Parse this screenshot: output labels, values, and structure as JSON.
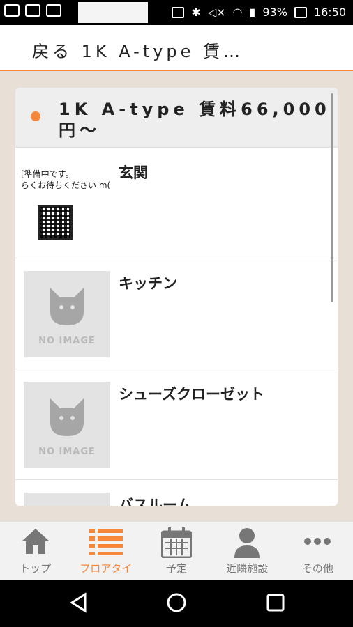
{
  "status_bar": {
    "battery": "93%",
    "time": "16:50"
  },
  "header": {
    "title": "戻る 1K A-type 賃…"
  },
  "card": {
    "title": "1K A-type 賃料66,000円～"
  },
  "rooms": [
    {
      "label": "玄関",
      "placeholder_lines": [
        "[準備中です。",
        "らくお待ちください m("
      ]
    },
    {
      "label": "キッチン",
      "no_image": "NO IMAGE"
    },
    {
      "label": "シューズクローゼット",
      "no_image": "NO IMAGE"
    },
    {
      "label": "バスルーム"
    }
  ],
  "bottom_nav": [
    {
      "label": "トップ",
      "icon": "home-icon"
    },
    {
      "label": "フロアタイ",
      "icon": "list-icon",
      "active": true
    },
    {
      "label": "予定",
      "icon": "calendar-icon"
    },
    {
      "label": "近隣施設",
      "icon": "person-icon"
    },
    {
      "label": "その他",
      "icon": "more-icon"
    }
  ],
  "colors": {
    "accent": "#f5883a",
    "background": "#e8e0d6"
  }
}
